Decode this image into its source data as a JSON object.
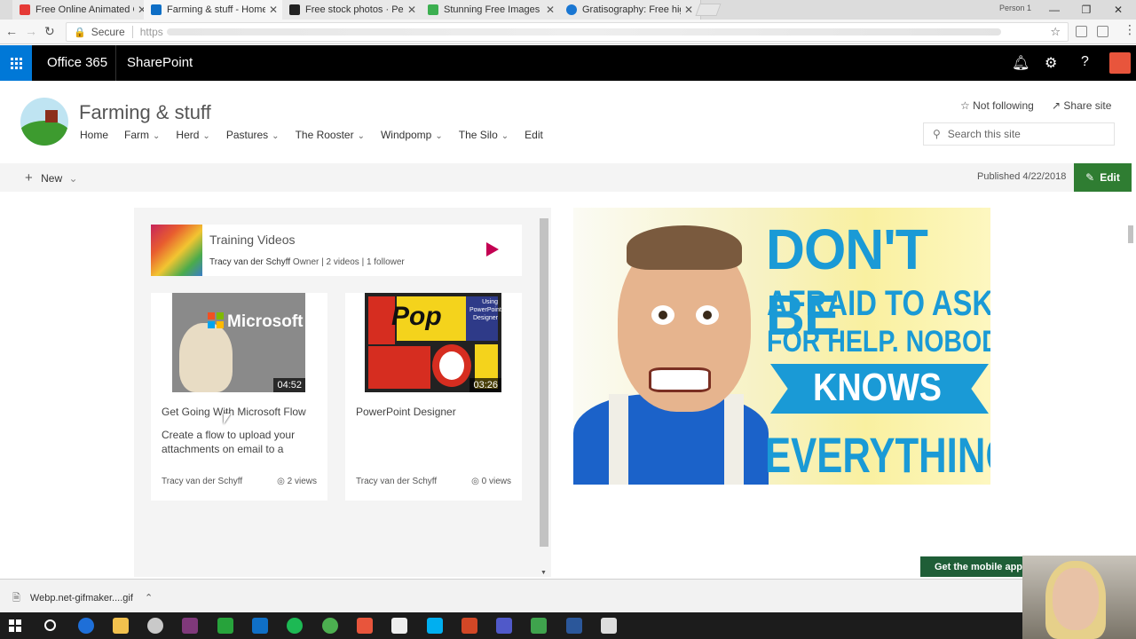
{
  "browser": {
    "tabs": [
      {
        "title": "Free Online Animated GI",
        "icon_color": "#e53935"
      },
      {
        "title": "Farming & stuff - Home",
        "icon_color": "#0f6fc6",
        "active": true
      },
      {
        "title": "Free stock photos · Pexe",
        "icon_color": "#222222"
      },
      {
        "title": "Stunning Free Images - P",
        "icon_color": "#3caf50"
      },
      {
        "title": "Gratisography: Free high",
        "icon_color": "#1976d2"
      }
    ],
    "close_glyph": "✕",
    "profile": "Person 1",
    "window_controls": [
      "—",
      "❐",
      "✕"
    ],
    "security_label": "Secure",
    "url": "https"
  },
  "suite": {
    "app_name": "Office 365",
    "product": "SharePoint",
    "icons": [
      "bell-icon",
      "gear-icon",
      "help-icon"
    ]
  },
  "site": {
    "title": "Farming & stuff",
    "nav": [
      {
        "label": "Home",
        "dropdown": false
      },
      {
        "label": "Farm",
        "dropdown": true
      },
      {
        "label": "Herd",
        "dropdown": true
      },
      {
        "label": "Pastures",
        "dropdown": true
      },
      {
        "label": "The Rooster",
        "dropdown": true
      },
      {
        "label": "Windpomp",
        "dropdown": true
      },
      {
        "label": "The Silo",
        "dropdown": true
      },
      {
        "label": "Edit",
        "dropdown": false
      }
    ],
    "follow_label": "Not following",
    "share_label": "Share site",
    "search_placeholder": "Search this site"
  },
  "commandbar": {
    "new_label": "New",
    "published": "Published 4/22/2018",
    "edit_label": "Edit"
  },
  "video_webpart": {
    "channel": {
      "title": "Training Videos",
      "owner": "Tracy van der Schyff",
      "meta": " Owner | 2 videos | 1 follower"
    },
    "videos": [
      {
        "title": "Get Going With Microsoft Flow",
        "duration": "04:52",
        "description": "Create a flow to upload your attachments on email to a",
        "author": "Tracy van der Schyff",
        "views": "2 views",
        "thumb_text": "Microsoft"
      },
      {
        "title": "PowerPoint Designer",
        "duration": "03:26",
        "description": "",
        "author": "Tracy van der Schyff",
        "views": "0 views",
        "thumb_text": "Pop",
        "thumb_caption": "Using PowerPoint Designer"
      }
    ]
  },
  "hero": {
    "line1": "DON'T BE",
    "line2": "AFRAID TO ASK",
    "line3": "FOR HELP. NOBODY",
    "line4": "KNOWS",
    "line5": "EVERYTHING"
  },
  "mobile_app_label": "Get the mobile app",
  "download": {
    "filename": "Webp.net-gifmaker....gif"
  },
  "colors": {
    "suite_bar": "#000000",
    "waffle": "#0078d7",
    "edit_button": "#2f7d32",
    "hero_text": "#1a9ad6",
    "mobile_app": "#1f5e37"
  }
}
